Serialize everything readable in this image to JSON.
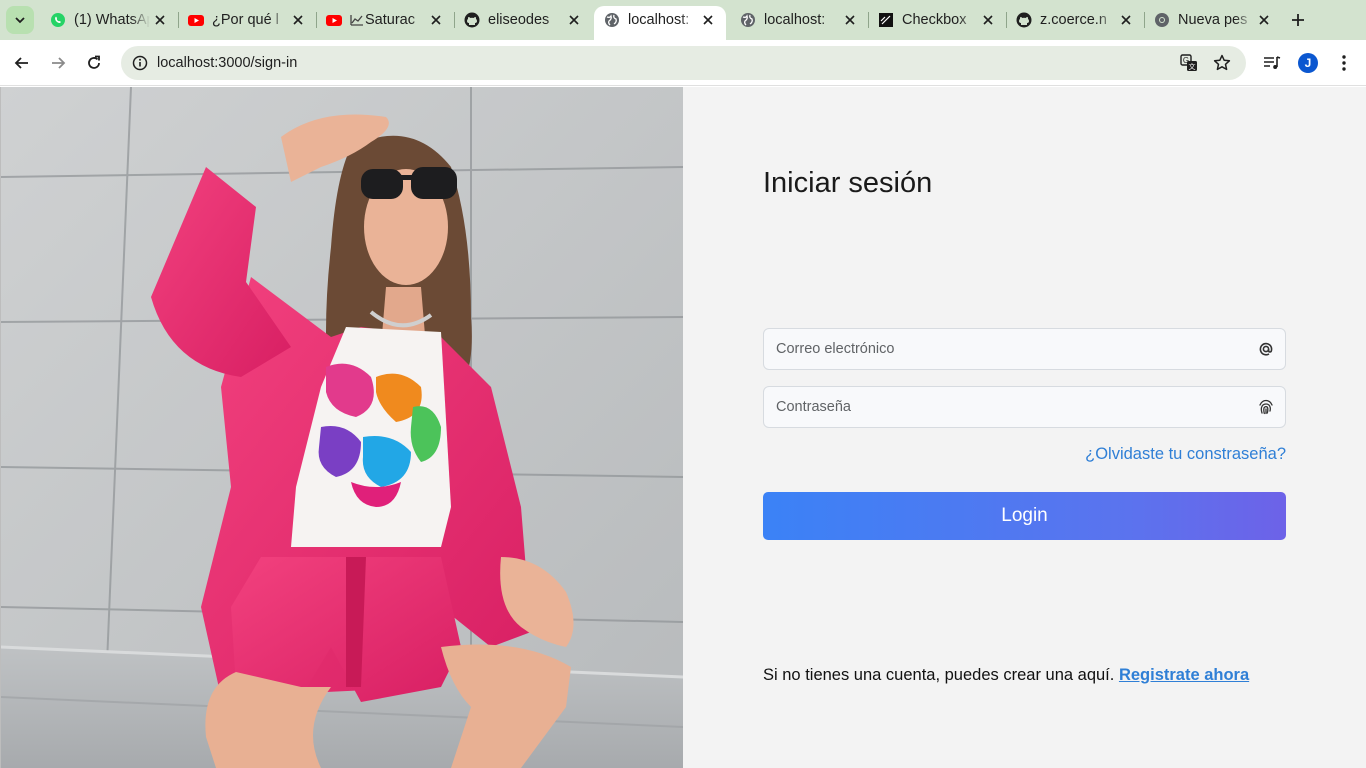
{
  "browser": {
    "tabs": [
      {
        "title": "(1) WhatsApp",
        "icon": "whatsapp-icon"
      },
      {
        "title": "¿Por qué l",
        "icon": "youtube-icon"
      },
      {
        "title": "Saturac",
        "icon": "youtube-icon"
      },
      {
        "title": "eliseodes",
        "icon": "github-icon"
      },
      {
        "title": "localhost:",
        "icon": "globe-icon",
        "active": true
      },
      {
        "title": "localhost:",
        "icon": "globe-icon"
      },
      {
        "title": "Checkbox",
        "icon": "checkbox-site-icon"
      },
      {
        "title": "z.coerce.n",
        "icon": "github-icon"
      },
      {
        "title": "Nueva pes",
        "icon": "chrome-icon"
      }
    ],
    "url": "localhost:3000/sign-in",
    "profile_initial": "J",
    "colors": {
      "tab_strip": "#d3e3cf",
      "omnibox": "#e6ece3",
      "avatar": "#0b57d0"
    }
  },
  "signin": {
    "title": "Iniciar sesión",
    "email_placeholder": "Correo electrónico",
    "email_icon": "at-icon",
    "password_placeholder": "Contraseña",
    "password_icon": "fingerprint-icon",
    "forgot_link": "¿Olvidaste tu constraseña?",
    "login_button": "Login",
    "signup_text": "Si no tienes una cuenta, puedes crear una aquí.",
    "signup_link": "Registrate ahora",
    "colors": {
      "link": "#2f7fd6",
      "button_start": "#3b82f6",
      "button_end": "#6d62e8",
      "panel_bg": "#f3f3f3"
    }
  }
}
